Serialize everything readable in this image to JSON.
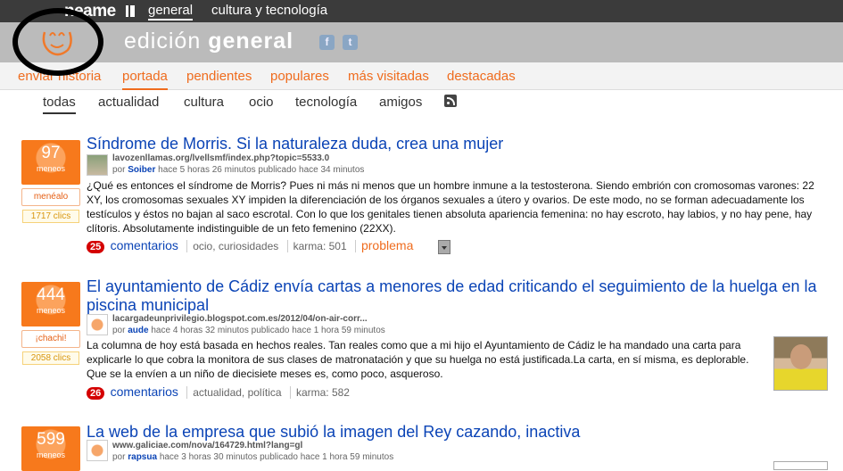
{
  "topbar": {
    "brand": "neame",
    "tabs": [
      {
        "label": "general"
      },
      {
        "label": "cultura y tecnología"
      }
    ]
  },
  "header": {
    "edition_prefix": "edición",
    "edition_name": "general",
    "social": [
      {
        "icon": "facebook-icon",
        "glyph": "f"
      },
      {
        "icon": "twitter-icon",
        "glyph": "t"
      }
    ]
  },
  "nav": {
    "items": [
      {
        "label": "enviar historia"
      },
      {
        "label": "portada"
      },
      {
        "label": "pendientes"
      },
      {
        "label": "populares"
      },
      {
        "label": "más visitadas"
      },
      {
        "label": "destacadas"
      }
    ]
  },
  "subnav": {
    "items": [
      {
        "label": "todas"
      },
      {
        "label": "actualidad"
      },
      {
        "label": "cultura"
      },
      {
        "label": "ocio"
      },
      {
        "label": "tecnología"
      },
      {
        "label": "amigos"
      }
    ],
    "rss_icon": "rss-icon"
  },
  "news": [
    {
      "votes": "97",
      "votes_label": "meneos",
      "action": "menéalo",
      "clicks": "1717 clics",
      "title": "Síndrome de Morris. Si la naturaleza duda, crea una mujer",
      "url": "lavozenllamas.org/lvellsmf/index.php?topic=5533.0",
      "by_prefix": "por",
      "user": "Soiber",
      "time": "hace 5 horas 26 minutos publicado hace 34 minutos",
      "body": "¿Qué es entonces el síndrome de Morris? Pues ni más ni menos que un hombre inmune a la testosterona. Siendo embrión con cromosomas varones: 22 XY, los cromosomas sexuales XY impiden la diferenciación de los órganos sexuales a útero y ovarios. De este modo, no se forman adecuadamente los testículos y éstos no bajan al saco escrotal. Con lo que los genitales tienen absoluta apariencia femenina: no hay escroto, hay labios, y no hay pene, hay clítoris. Absolutamente indistinguible de un feto femenino (22XX).",
      "comments_count": "25",
      "comments_label": "comentarios",
      "tags": "ocio, curiosidades",
      "karma": "karma: 501",
      "problem": "problema"
    },
    {
      "votes": "444",
      "votes_label": "meneos",
      "action": "¡chachi!",
      "clicks": "2058 clics",
      "title": "El ayuntamiento de Cádiz envía cartas a menores de edad criticando el seguimiento de la huelga en la piscina municipal",
      "url": "lacargadeunprivilegio.blogspot.com.es/2012/04/on-air-corr...",
      "by_prefix": "por",
      "user": "aude",
      "time": "hace 4 horas 32 minutos publicado hace 1 hora 59 minutos",
      "body": "La columna de hoy está basada en hechos reales. Tan reales como que a mi hijo el Ayuntamiento de Cádiz le ha mandado una carta para explicarle lo que cobra la monitora de sus clases de matronatación y que su huelga no está justificada.La carta, en sí misma, es deplorable. Que se la envíen a un niño de diecisiete meses es, como poco, asqueroso.",
      "comments_count": "26",
      "comments_label": "comentarios",
      "tags": "actualidad, política",
      "karma": "karma: 582"
    },
    {
      "votes": "599",
      "votes_label": "meneos",
      "title": "La web de la empresa que subió la imagen del Rey cazando, inactiva",
      "url": "www.galiciae.com/nova/164729.html?lang=gl",
      "by_prefix": "por",
      "user": "rapsua",
      "time": "hace 3 horas 30 minutos publicado hace 1 hora 59 minutos"
    }
  ]
}
